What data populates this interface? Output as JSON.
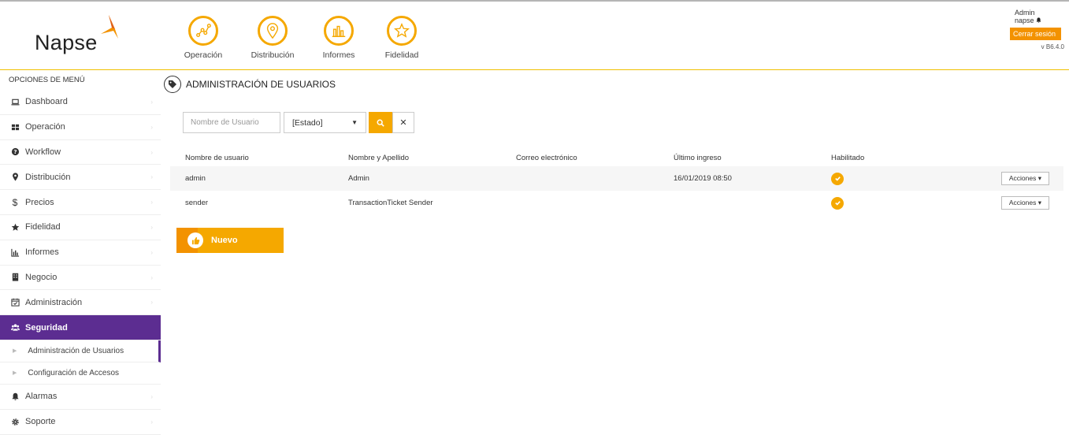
{
  "header": {
    "brand": "Napse",
    "nav": [
      {
        "label": "Operación",
        "icon": "chart-line-icon"
      },
      {
        "label": "Distribución",
        "icon": "map-pin-icon"
      },
      {
        "label": "Informes",
        "icon": "bar-chart-icon"
      },
      {
        "label": "Fidelidad",
        "icon": "star-icon"
      }
    ],
    "user": {
      "name": "Admin",
      "org": "napse",
      "logout_label": "Cerrar sesión",
      "version": "v B6.4.0"
    }
  },
  "sidebar": {
    "title": "OPCIONES DE MENÚ",
    "items": [
      {
        "label": "Dashboard",
        "icon": "laptop-icon"
      },
      {
        "label": "Operación",
        "icon": "grid-icon"
      },
      {
        "label": "Workflow",
        "icon": "question-icon"
      },
      {
        "label": "Distribución",
        "icon": "map-marker-icon"
      },
      {
        "label": "Precios",
        "icon": "dollar-icon"
      },
      {
        "label": "Fidelidad",
        "icon": "star-icon"
      },
      {
        "label": "Informes",
        "icon": "bar-chart-icon"
      },
      {
        "label": "Negocio",
        "icon": "building-icon"
      },
      {
        "label": "Administración",
        "icon": "calendar-check-icon"
      },
      {
        "label": "Seguridad",
        "icon": "users-icon",
        "active": true
      }
    ],
    "subitems": [
      {
        "label": "Administración de Usuarios",
        "current": true
      },
      {
        "label": "Configuración de Accesos"
      }
    ],
    "items_after": [
      {
        "label": "Alarmas",
        "icon": "bell-icon"
      },
      {
        "label": "Soporte",
        "icon": "gear-icon"
      }
    ]
  },
  "main": {
    "title": "ADMINISTRACIÓN DE USUARIOS",
    "filters": {
      "username_placeholder": "Nombre de Usuario",
      "status_value": "[Estado]"
    },
    "table": {
      "columns": [
        "Nombre de usuario",
        "Nombre y Apellido",
        "Correo electrónico",
        "Último ingreso",
        "Habilitado"
      ],
      "rows": [
        {
          "username": "admin",
          "fullname": "Admin",
          "email": "",
          "last_login": "16/01/2019 08:50",
          "enabled": true,
          "actions": "Acciones"
        },
        {
          "username": "sender",
          "fullname": "TransactionTicket Sender",
          "email": "",
          "last_login": "",
          "enabled": true,
          "actions": "Acciones"
        }
      ]
    },
    "new_button": "Nuevo"
  },
  "colors": {
    "accent": "#f5a800",
    "accent_dark": "#f39200",
    "purple": "#5c2d91"
  }
}
